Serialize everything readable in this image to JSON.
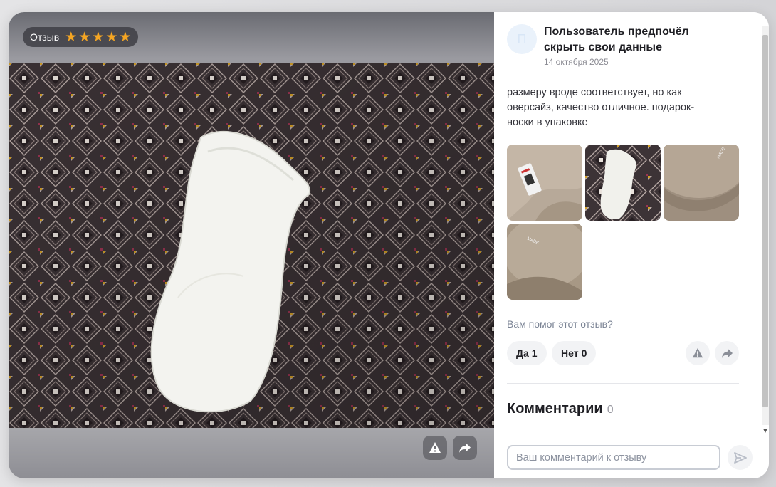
{
  "review": {
    "badge_label": "Отзыв",
    "rating": 5,
    "author": {
      "initial": "П",
      "name": "Пользователь предпочёл скрыть свои данные",
      "date": "14 октября 2025"
    },
    "text": "размеру вроде соответствует, но как оверсайз, качество отличное. подарок-носки в упаковке",
    "photos": [
      "beige-tshirt-with-tag",
      "white-sock-on-pattern",
      "beige-tshirt-collar",
      "beige-tshirt-label"
    ]
  },
  "helpful": {
    "question": "Вам помог этот отзыв?",
    "yes_label": "Да",
    "yes_count": "1",
    "no_label": "Нет",
    "no_count": "0"
  },
  "comments": {
    "title": "Комментарии",
    "count": "0",
    "placeholder": "Ваш комментарий к отзыву"
  },
  "icons": {
    "star": "star-icon",
    "report": "report-icon",
    "share": "share-icon",
    "send": "send-icon",
    "scroll_up": "▲",
    "scroll_down": "▼"
  },
  "colors": {
    "star": "#f5a623",
    "accent_gray": "#f2f3f5"
  }
}
